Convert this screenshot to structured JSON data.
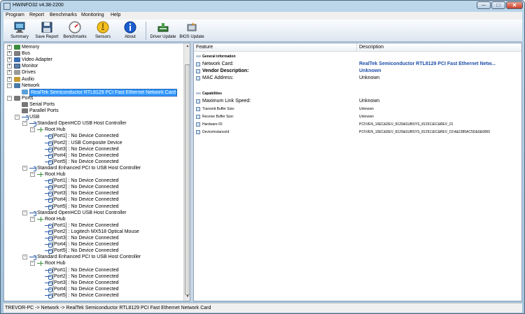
{
  "window": {
    "title": "HWiNFO32 v4.38-2200",
    "min": "─",
    "max": "□",
    "close": "✕"
  },
  "menu": [
    "Program",
    "Report",
    "Benchmarks",
    "Monitoring",
    "Help"
  ],
  "toolbar": [
    {
      "label": "Summary",
      "icon": "summary-icon"
    },
    {
      "label": "Save Report",
      "icon": "floppy-disk-icon"
    },
    {
      "label": "Benchmarks",
      "icon": "gauge-icon"
    },
    {
      "label": "Sensors",
      "icon": "sensors-icon"
    },
    {
      "label": "About",
      "icon": "info-icon"
    },
    {
      "label": "Driver Update",
      "icon": "driver-update-icon"
    },
    {
      "label": "BIOS Update",
      "icon": "bios-update-icon"
    }
  ],
  "tree": {
    "top_items": [
      "Memory",
      "Bus",
      "Video Adapter",
      "Monitor",
      "Drives",
      "Audio",
      "Network"
    ],
    "network_child": "RealTek Semiconductor RTL8129 PCI Fast Ethernet Network Card",
    "ports": "Ports",
    "port_children": [
      "Serial Ports",
      "Parallel Ports"
    ],
    "usb": "USB",
    "root_hub": "Root Hub",
    "controllers": [
      {
        "name": "Standard OpenHCD USB Host Controller",
        "ports": [
          "[Port1] : No Device Connected",
          "[Port2] : USB Composite Device",
          "[Port3] : No Device Connected",
          "[Port4] : No Device Connected",
          "[Port5] : No Device Connected"
        ]
      },
      {
        "name": "Standard Enhanced PCI to USB Host Controller",
        "ports": [
          "[Port1] : No Device Connected",
          "[Port2] : No Device Connected",
          "[Port3] : No Device Connected",
          "[Port4] : No Device Connected",
          "[Port5] : No Device Connected"
        ]
      },
      {
        "name": "Standard OpenHCD USB Host Controller",
        "ports": [
          "[Port1] : No Device Connected",
          "[Port2] : Logitech MX518 Optical Mouse",
          "[Port3] : No Device Connected",
          "[Port4] : No Device Connected",
          "[Port5] : No Device Connected"
        ]
      },
      {
        "name": "Standard Enhanced PCI to USB Host Controller",
        "ports": [
          "[Port1] : No Device Connected",
          "[Port2] : No Device Connected",
          "[Port3] : No Device Connected",
          "[Port4] : No Device Connected",
          "[Port5] : No Device Connected"
        ]
      }
    ]
  },
  "details": {
    "col_feature": "Feature",
    "col_description": "Description",
    "rows": [
      {
        "kind": "section",
        "feature": "General information"
      },
      {
        "kind": "big",
        "feature": "Network Card:",
        "value": "RealTek Semiconductor RTL8129 PCI Fast Ethernet Netw...",
        "vstyle": "blue"
      },
      {
        "kind": "big-bold",
        "feature": "Vendor Description:",
        "value": "Unknown",
        "vstyle": "blue"
      },
      {
        "kind": "big",
        "feature": "MAC Address:",
        "value": "Unknown",
        "vstyle": ""
      },
      {
        "kind": "blank"
      },
      {
        "kind": "section",
        "feature": "Capabilities"
      },
      {
        "kind": "big",
        "feature": "Maximum Link Speed:",
        "value": "Unknown",
        "vstyle": ""
      },
      {
        "kind": "small",
        "feature": "Transmit Buffer Size:",
        "value": "Unknown",
        "vstyle": ""
      },
      {
        "kind": "small",
        "feature": "Receive Buffer Size:",
        "value": "Unknown",
        "vstyle": ""
      },
      {
        "kind": "small",
        "feature": "Hardware ID:",
        "value": "PCI\\VEN_10EC&DEV_8129&SUBSYS_812911EC&REV_01",
        "vstyle": ""
      },
      {
        "kind": "small",
        "feature": "DeviceInstanceId",
        "value": "PCI\\VEN_10EC&DEV_8129&SUBSYS_812911EC&REV_01\\4&2385AC5D&0&0060",
        "vstyle": ""
      }
    ]
  },
  "status": "TREVOR-PC -> Network -> RealTek Semiconductor RTL8129 PCI Fast Ethernet Network Card"
}
